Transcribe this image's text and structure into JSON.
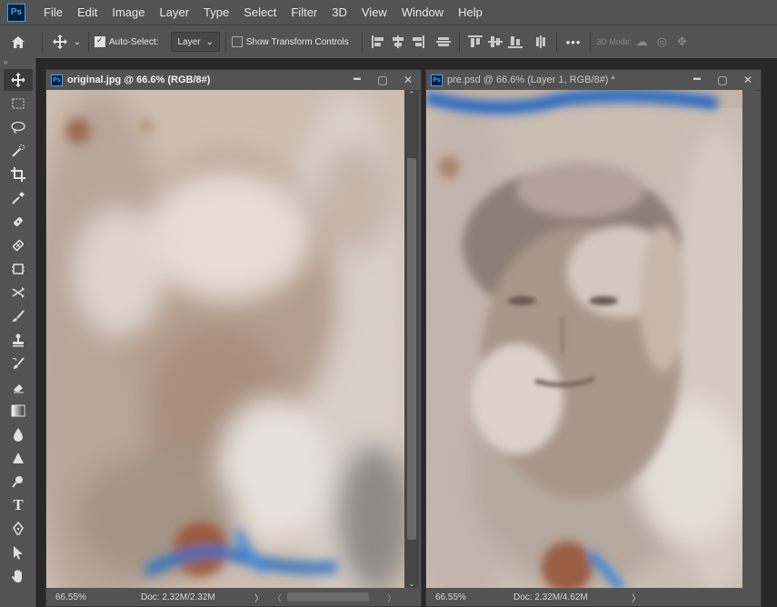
{
  "app": {
    "logo_text": "Ps"
  },
  "menu": [
    "File",
    "Edit",
    "Image",
    "Layer",
    "Type",
    "Select",
    "Filter",
    "3D",
    "View",
    "Window",
    "Help"
  ],
  "options_bar": {
    "auto_select_label": "Auto-Select:",
    "auto_select_target": "Layer",
    "show_transform_label": "Show Transform Controls",
    "more": "•••",
    "mode_3d_label": "3D Mode:"
  },
  "tools": [
    "move-tool",
    "marquee-tool",
    "lasso-tool",
    "quick-selection-tool",
    "crop-tool",
    "eyedropper-tool",
    "healing-brush-tool",
    "patch-tool",
    "content-aware-move-tool",
    "red-eye-tool",
    "brush-tool",
    "clone-stamp-tool",
    "history-brush-tool",
    "eraser-tool",
    "gradient-tool",
    "blur-tool",
    "sharpen-tool",
    "dodge-tool",
    "type-tool",
    "pen-tool",
    "path-selection-tool",
    "hand-tool"
  ],
  "documents": [
    {
      "title": "original.jpg @ 66.6% (RGB/8#)",
      "zoom": "66.55%",
      "doc_info": "Doc: 2.32M/2.32M",
      "arrow": "〉"
    },
    {
      "title": "pre.psd @ 66.6% (Layer 1, RGB/8#) *",
      "zoom": "66.55%",
      "doc_info": "Doc: 2.32M/4.62M",
      "arrow": "〉"
    }
  ],
  "window_controls": {
    "minimize": "▬",
    "maximize": "▢",
    "close": "✕"
  },
  "scroll_arrows": {
    "up": "⌃",
    "down": "⌄",
    "left": "〈",
    "right": "〉"
  },
  "colors": {
    "panel": "#535353",
    "background": "#282828",
    "accent": "#31a8ff"
  }
}
